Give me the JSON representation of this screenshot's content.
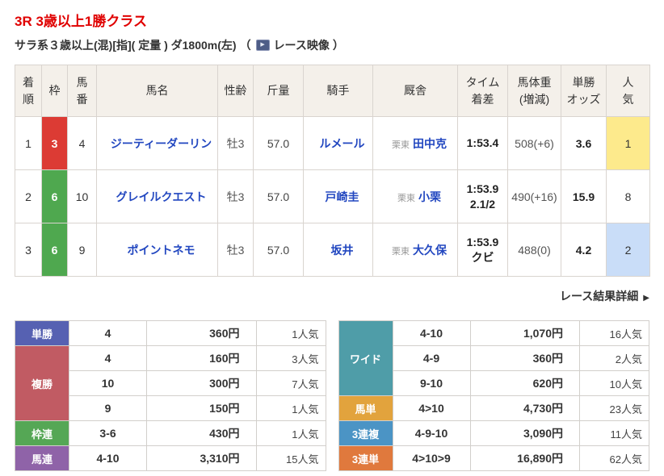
{
  "page": {
    "race_title": "3R 3歳以上1勝クラス",
    "race_conditions": "サラ系３歳以上(混)[指]( 定量 ) ダ1800m(左)",
    "video_open_paren": "（",
    "video_label": "レース映像",
    "video_close_paren": "）",
    "video_icon_glyph": "▶",
    "details_link": "レース結果詳細",
    "details_arrow": "▶"
  },
  "results": {
    "headers": {
      "rank": "着\n順",
      "waku": "枠",
      "num": "馬\n番",
      "horse": "馬名",
      "sexage": "性齢",
      "weight": "斤量",
      "jockey": "騎手",
      "stable": "厩舎",
      "time": "タイム\n着差",
      "body": "馬体重\n(増減)",
      "odds": "単勝\nオッズ",
      "pop": "人\n気"
    },
    "rows": [
      {
        "rank": "1",
        "waku": "3",
        "waku_color": "#dc3b34",
        "num": "4",
        "horse": "ジーティーダーリン",
        "sexage": "牡3",
        "weight": "57.0",
        "jockey": "ルメール",
        "stable_area": "栗東",
        "stable": "田中克",
        "time": "1:53.4",
        "margin": "",
        "body": "508(+6)",
        "odds": "3.6",
        "pop": "1",
        "pop_bg": "#fdea8c"
      },
      {
        "rank": "2",
        "waku": "6",
        "waku_color": "#4fa84f",
        "num": "10",
        "horse": "グレイルクエスト",
        "sexage": "牡3",
        "weight": "57.0",
        "jockey": "戸崎圭",
        "stable_area": "栗東",
        "stable": "小栗",
        "time": "1:53.9",
        "margin": "2.1/2",
        "body": "490(+16)",
        "odds": "15.9",
        "pop": "8",
        "pop_bg": ""
      },
      {
        "rank": "3",
        "waku": "6",
        "waku_color": "#4fa84f",
        "num": "9",
        "horse": "ポイントネモ",
        "sexage": "牡3",
        "weight": "57.0",
        "jockey": "坂井",
        "stable_area": "栗東",
        "stable": "大久保",
        "time": "1:53.9",
        "margin": "クビ",
        "body": "488(0)",
        "odds": "4.2",
        "pop": "2",
        "pop_bg": "#c9ddf8"
      }
    ]
  },
  "payouts": {
    "left": [
      {
        "label": "単勝",
        "color": "#5661b2",
        "rows": [
          [
            "4",
            "360円",
            "1人気"
          ]
        ]
      },
      {
        "label": "複勝",
        "color": "#c15b63",
        "rows": [
          [
            "4",
            "160円",
            "3人気"
          ],
          [
            "10",
            "300円",
            "7人気"
          ],
          [
            "9",
            "150円",
            "1人気"
          ]
        ]
      },
      {
        "label": "枠連",
        "color": "#55a755",
        "rows": [
          [
            "3-6",
            "430円",
            "1人気"
          ]
        ]
      },
      {
        "label": "馬連",
        "color": "#8f63a8",
        "rows": [
          [
            "4-10",
            "3,310円",
            "15人気"
          ]
        ]
      }
    ],
    "right": [
      {
        "label": "ワイド",
        "color": "#4f9da8",
        "rows": [
          [
            "4-10",
            "1,070円",
            "16人気"
          ],
          [
            "4-9",
            "360円",
            "2人気"
          ],
          [
            "9-10",
            "620円",
            "10人気"
          ]
        ]
      },
      {
        "label": "馬単",
        "color": "#e2a33d",
        "rows": [
          [
            "4>10",
            "4,730円",
            "23人気"
          ]
        ]
      },
      {
        "label": "3連複",
        "color": "#4b94c5",
        "rows": [
          [
            "4-9-10",
            "3,090円",
            "11人気"
          ]
        ]
      },
      {
        "label": "3連単",
        "color": "#e0793d",
        "rows": [
          [
            "4>10>9",
            "16,890円",
            "62人気"
          ]
        ]
      }
    ]
  }
}
